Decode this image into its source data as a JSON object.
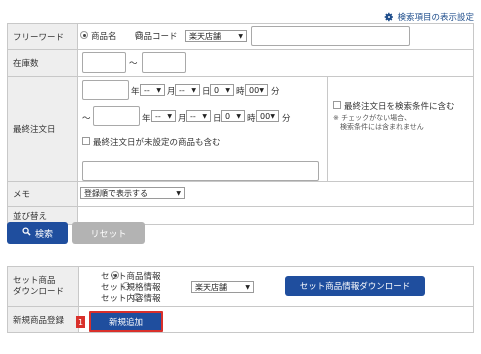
{
  "settings_link": {
    "label": "検索項目の表示設定",
    "icon": "gear-icon"
  },
  "rows": {
    "freeword": {
      "label": "フリーワード",
      "radio_product_name": "商品名",
      "radio_product_code": "商品コード",
      "shop_select": "楽天店舗"
    },
    "stock": {
      "label": "在庫数",
      "tilde": "～"
    },
    "last_order": {
      "label": "最終注文日",
      "from_tilde": "",
      "to_tilde": "～",
      "year": "年",
      "month": "月",
      "day": "日",
      "hour": "時",
      "minute": "分",
      "dash": "--",
      "day_value": "0",
      "hour_value": "0",
      "minute_value": "00",
      "include_unset": "最終注文日が未設定の商品も含む",
      "use_as_condition": "最終注文日を検索条件に含む",
      "note_line1": "※ チェックがない場合、",
      "note_line2": "検索条件には含まれません"
    },
    "memo": {
      "label": "メモ"
    },
    "sort": {
      "label": "並び替え",
      "value": "登録順で表示する"
    }
  },
  "buttons": {
    "search": "検索",
    "reset": "リセット"
  },
  "set_table": {
    "set_download_label_line1": "セット商品",
    "set_download_label_line2": "ダウンロード",
    "options": [
      "セット商品情報",
      "セット規格情報",
      "セット内容情報"
    ],
    "shop_select": "楽天店舗",
    "download_button": "セット商品情報ダウンロード",
    "new_register_label": "新規商品登録",
    "new_add_button": "新規追加",
    "badge": "1"
  },
  "colors": {
    "primary": "#1f4e9e",
    "label_bg": "#eeeeee",
    "badge": "#d9302b"
  }
}
